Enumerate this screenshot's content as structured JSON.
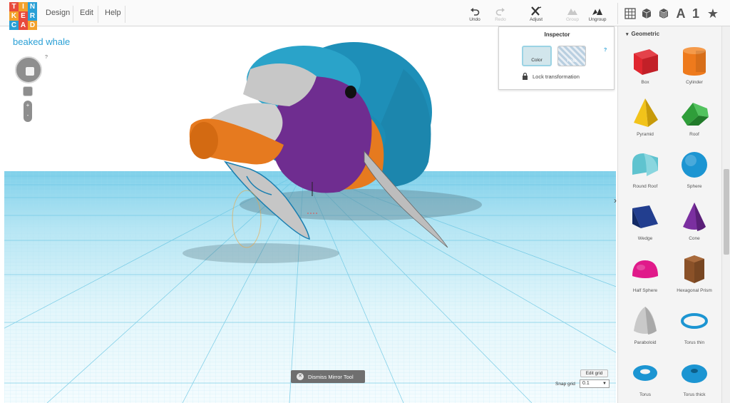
{
  "app": {
    "logo_letters": [
      "T",
      "I",
      "N",
      "K",
      "E",
      "R",
      "C",
      "A",
      "D"
    ],
    "logo_colors": [
      "#e84a3b",
      "#f3a12b",
      "#2aa0d6",
      "#f3a12b",
      "#e84a3b",
      "#2aa0d6",
      "#2aa0d6",
      "#e84a3b",
      "#f3a12b"
    ]
  },
  "menu": {
    "design": "Design",
    "edit": "Edit",
    "help": "Help"
  },
  "toolbar": {
    "undo": "Undo",
    "redo": "Redo",
    "adjust": "Adjust",
    "group": "Group",
    "ungroup": "Ungroup",
    "text_icon": "A",
    "number_icon": "1",
    "star_icon": "★"
  },
  "workplane": {
    "design_title": "beaked whale",
    "help": "?",
    "zoom_plus": "+",
    "zoom_minus": "-"
  },
  "inspector": {
    "title": "Inspector",
    "color_label": "Color",
    "hole_label": "Hole",
    "help": "?",
    "lock_label": "Lock transformation"
  },
  "sidebar": {
    "category": "Geometric",
    "shapes": [
      {
        "name": "Box",
        "icon": "box-icon",
        "color": "#e0262f"
      },
      {
        "name": "Cylinder",
        "icon": "cylinder-icon",
        "color": "#ee7a1c"
      },
      {
        "name": "Pyramid",
        "icon": "pyramid-icon",
        "color": "#f2c31a"
      },
      {
        "name": "Roof",
        "icon": "roof-icon",
        "color": "#2f9e3a"
      },
      {
        "name": "Round Roof",
        "icon": "round-roof-icon",
        "color": "#5fc3cf"
      },
      {
        "name": "Sphere",
        "icon": "sphere-icon",
        "color": "#1c95d2"
      },
      {
        "name": "Wedge",
        "icon": "wedge-icon",
        "color": "#223e8f"
      },
      {
        "name": "Cone",
        "icon": "cone-icon",
        "color": "#7b2fa0"
      },
      {
        "name": "Half Sphere",
        "icon": "half-sphere-icon",
        "color": "#e01a8a"
      },
      {
        "name": "Hexagonal Prism",
        "icon": "hexagonal-prism-icon",
        "color": "#8a5128"
      },
      {
        "name": "Paraboloid",
        "icon": "paraboloid-icon",
        "color": "#c9c9c9"
      },
      {
        "name": "Torus thin",
        "icon": "torus-thin-icon",
        "color": "#1c95d2"
      },
      {
        "name": "Torus",
        "icon": "torus-icon",
        "color": "#1c95d2"
      },
      {
        "name": "Torus thick",
        "icon": "torus-thick-icon",
        "color": "#1c95d2"
      }
    ]
  },
  "bottom": {
    "dismiss_label": "Dismiss Mirror Tool",
    "edit_grid_label": "Edit grid",
    "snap_grid_label": "Snap grid",
    "snap_grid_value": "0.1"
  },
  "colors": {
    "accent": "#2aa0d6",
    "whale_blue": "#1a8fba",
    "whale_purple": "#6f2d90",
    "whale_orange": "#e67a1f",
    "whale_gray": "#c7c7c7",
    "grid_line": "#8fd3ea"
  }
}
